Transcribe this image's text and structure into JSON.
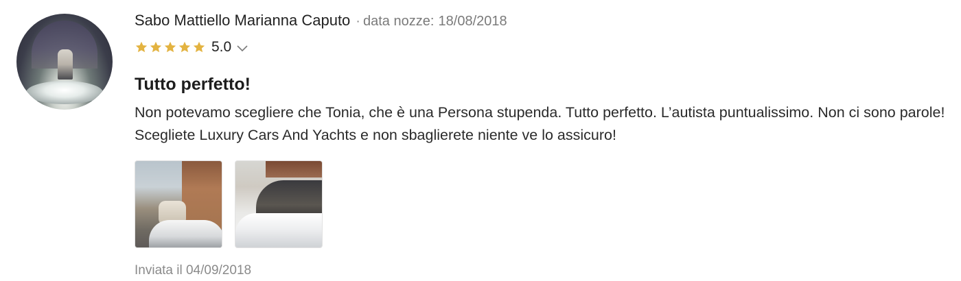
{
  "review": {
    "author": "Sabo Mattiello Marianna Caputo",
    "separator": "·",
    "wedding_label": "data nozze:",
    "wedding_date": "18/08/2018",
    "rating": {
      "stars": 5,
      "max_stars": 5,
      "value_text": "5.0",
      "star_color": "#e3b341"
    },
    "title": "Tutto perfetto!",
    "body": "Non potevamo scegliere che Tonia, che è una Persona stupenda. Tutto perfetto. L’autista puntualissimo. Non ci sono parole! Scegliete Luxury Cars And Yachts e non sbaglierete niente ve lo assicuro!",
    "photos_count": 2,
    "sent_text": "Inviata il 04/09/2018"
  },
  "icons": {
    "star": "star-icon",
    "chevron": "chevron-down-icon"
  }
}
